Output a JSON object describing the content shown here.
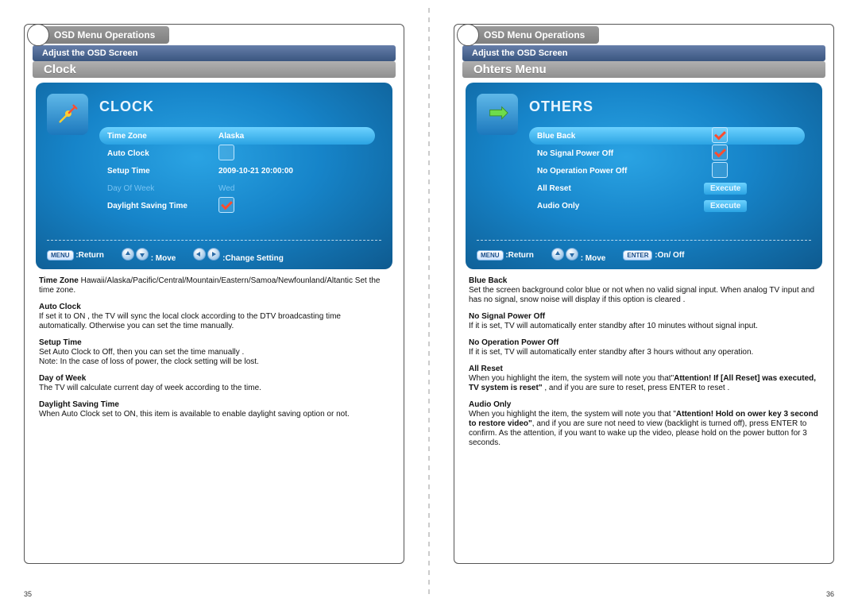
{
  "pages": {
    "left": {
      "header_tab": "OSD Menu Operations",
      "sub_bar": "Adjust the OSD Screen",
      "section_title": "Clock",
      "page_num": "35",
      "osd": {
        "title": "CLOCK",
        "rows": {
          "r0_label": "Time Zone",
          "r0_val": "Alaska",
          "r1_label": "Auto Clock",
          "r2_label": "Setup Time",
          "r2_val": "2009-10-21   20:00:00",
          "r3_label": "Day Of Week",
          "r3_val": "Wed",
          "r4_label": "Daylight Saving Time"
        },
        "legend": {
          "menu_pill": "MENU",
          "return": ":Return",
          "move": ":  Move",
          "change": ":Change Setting"
        }
      },
      "desc": {
        "tz_title": "Time Zone",
        "tz_body": "  Hawaii/Alaska/Pacific/Central/Mountain/Eastern/Samoa/Newfounland/Altantic Set the time zone.",
        "ac_title": "Auto Clock",
        "ac_body": "If set it to ON , the TV will sync the local clock according to the DTV broadcasting time automatically. Otherwise you can set the time manually.",
        "st_title": "Setup Time",
        "st_body1": "Set Auto Clock to Off, then you can set the time manually .",
        "st_body2": "Note:   In the case of loss of power, the clock setting will be lost.",
        "dw_title": "Day of Week",
        "dw_body": "The TV will calculate current day of week  according to the time.",
        "dst_title": "Daylight Saving Time",
        "dst_body": "When Auto Clock set to ON,  this  item  is  available to enable daylight saving option or not."
      }
    },
    "right": {
      "header_tab": "OSD Menu Operations",
      "sub_bar": "Adjust the OSD Screen",
      "section_title": "Ohters Menu",
      "page_num": "36",
      "osd": {
        "title": "OTHERS",
        "rows": {
          "r0_label": "Blue Back",
          "r1_label": "No Signal Power Off",
          "r2_label": "No Operation Power Off",
          "r3_label": "All Reset",
          "r3_val": "Execute",
          "r4_label": "Audio Only",
          "r4_val": "Execute"
        },
        "legend": {
          "menu_pill": "MENU",
          "return": ":Return",
          "move": ":  Move",
          "enter_pill": "ENTER",
          "onoff": ":On/ Off"
        }
      },
      "desc": {
        "bb_title": "Blue Back",
        "bb_body": "Set the screen background color blue or not when no valid signal input.  When analog TV input and has no signal, snow noise will display if this option is cleared .",
        "ns_title": "No Signal Power Off",
        "ns_body": "If it is set, TV will automatically enter standby after 10 minutes without signal input.",
        "no_title": "No Operation Power Off",
        "no_body": "If it is set, TV will automatically enter standby after 3 hours without any operation.",
        "ar_title": "All Reset",
        "ar_body_pre": "When you highlight the item, the system will note you that\"",
        "ar_body_bold": "Attention! If [All Reset] was executed, TV system is reset\" ",
        "ar_body_post": ",  and if you are sure to reset, press ENTER to reset .",
        "ao_title": "Audio Only",
        "ao_body_pre": "When you highlight the item, the system will note you that \"",
        "ao_body_bold": "Attention! Hold on ower key 3 second to restore video\"",
        "ao_body_post": ", and if you are sure not need to view (backlight is turned off), press ENTER to confirm. As the attention, if you want to wake up the video, please hold on the power button for 3 seconds."
      }
    }
  }
}
